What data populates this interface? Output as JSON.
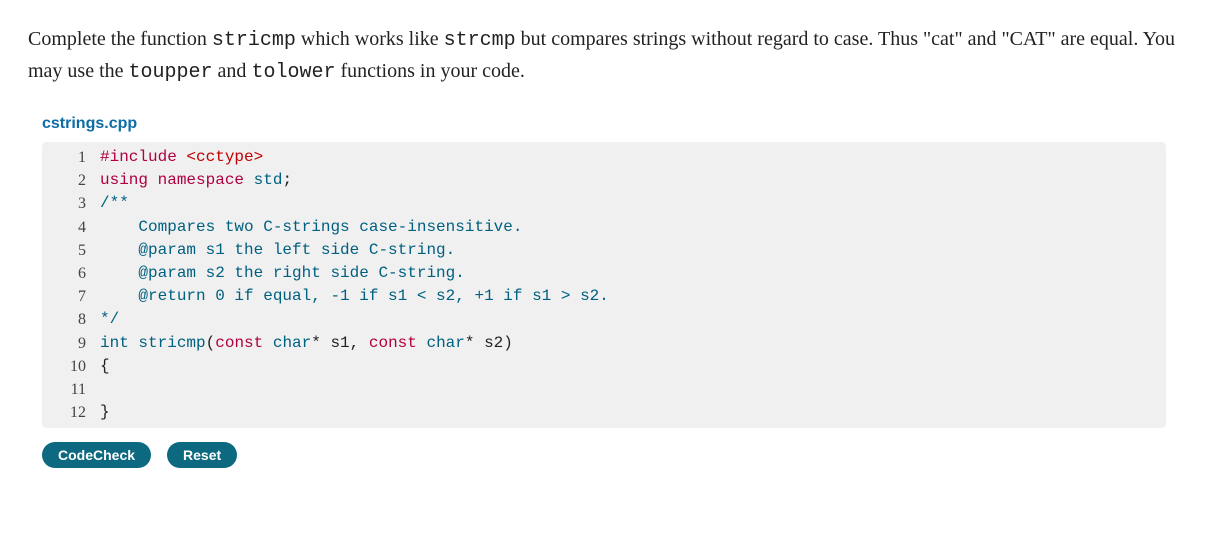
{
  "instructions": {
    "part1": "Complete the function ",
    "code1": "stricmp",
    "part2": " which works like ",
    "code2": "strcmp",
    "part3": " but compares strings without regard to case. Thus \"cat\" and \"CAT\" are equal. You may use the ",
    "code3": "toupper",
    "part4": " and ",
    "code4": "tolower",
    "part5": " functions in your code."
  },
  "filename": "cstrings.cpp",
  "code": {
    "lines": [
      {
        "n": "1",
        "tokens": [
          [
            "tok-pp",
            "#include "
          ],
          [
            "tok-inc",
            "<cctype>"
          ]
        ]
      },
      {
        "n": "2",
        "tokens": [
          [
            "tok-kw",
            "using "
          ],
          [
            "tok-kw",
            "namespace "
          ],
          [
            "tok-ns",
            "std"
          ],
          [
            "",
            ";"
          ]
        ]
      },
      {
        "n": "3",
        "tokens": [
          [
            "tok-cm",
            "/**"
          ]
        ]
      },
      {
        "n": "4",
        "tokens": [
          [
            "tok-cm",
            "    Compares two C-strings case-insensitive."
          ]
        ]
      },
      {
        "n": "5",
        "tokens": [
          [
            "tok-cm",
            "    @param s1 the left side C-string."
          ]
        ]
      },
      {
        "n": "6",
        "tokens": [
          [
            "tok-cm",
            "    @param s2 the right side C-string."
          ]
        ]
      },
      {
        "n": "7",
        "tokens": [
          [
            "tok-cm",
            "    @return 0 if equal, -1 if s1 < s2, +1 if s1 > s2."
          ]
        ]
      },
      {
        "n": "8",
        "tokens": [
          [
            "tok-cm",
            "*/"
          ]
        ]
      },
      {
        "n": "9",
        "tokens": [
          [
            "tok-type",
            "int "
          ],
          [
            "tok-fn",
            "stricmp"
          ],
          [
            "",
            "("
          ],
          [
            "tok-kw",
            "const "
          ],
          [
            "tok-type",
            "char"
          ],
          [
            "",
            "* s1, "
          ],
          [
            "tok-kw",
            "const "
          ],
          [
            "tok-type",
            "char"
          ],
          [
            "",
            "* s2)"
          ]
        ]
      },
      {
        "n": "10",
        "tokens": [
          [
            "",
            "{"
          ]
        ]
      },
      {
        "n": "11",
        "tokens": [
          [
            "",
            ""
          ]
        ]
      },
      {
        "n": "12",
        "tokens": [
          [
            "",
            "}"
          ]
        ]
      }
    ]
  },
  "buttons": {
    "codecheck": "CodeCheck",
    "reset": "Reset"
  }
}
